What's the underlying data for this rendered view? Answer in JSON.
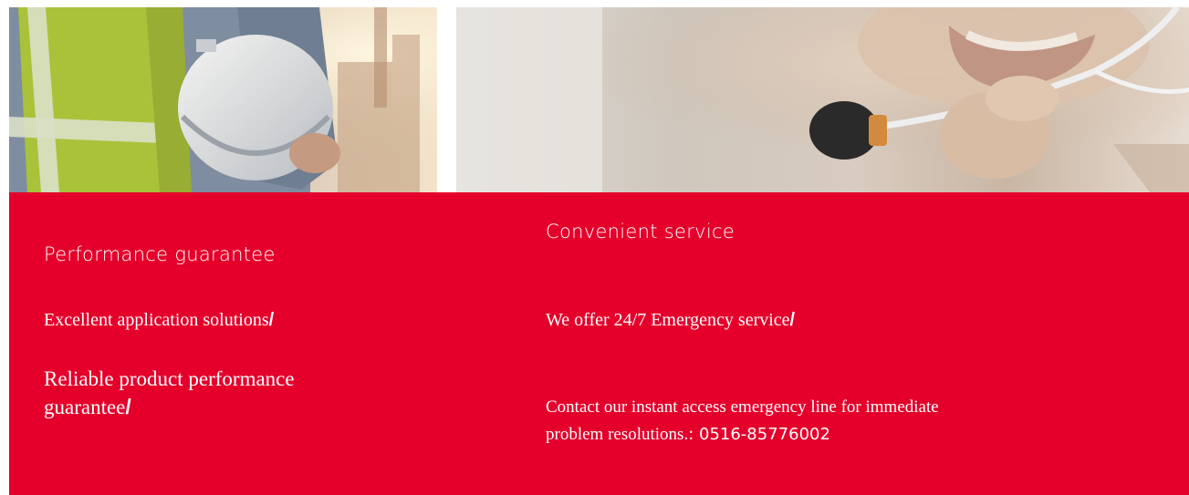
{
  "images": {
    "left": {
      "icon": "construction-worker-hardhat-photo",
      "colors": [
        "#8e97a4",
        "#b6c94a",
        "#f2e3c9"
      ]
    },
    "right": {
      "icon": "microphone-closeup-photo",
      "colors": [
        "#dedbd6",
        "#c9b6a4",
        "#2b2b2b"
      ]
    }
  },
  "theme": {
    "accent": "#e4002b",
    "text": "#ffffff"
  },
  "left_column": {
    "heading": "Performance guarantee",
    "item1": "Excellent application solutions",
    "item2_line1": "Reliable product performance",
    "item2_line2": "guarantee",
    "separator": "/"
  },
  "right_column": {
    "heading": "Convenient service",
    "item1": "We offer 24/7 Emergency service",
    "separator": "/",
    "contact_line1": "Contact our instant access emergency line for immediate",
    "contact_line2": "problem resolutions.",
    "phone_prefix": ": ",
    "phone": "0516-85776002"
  }
}
